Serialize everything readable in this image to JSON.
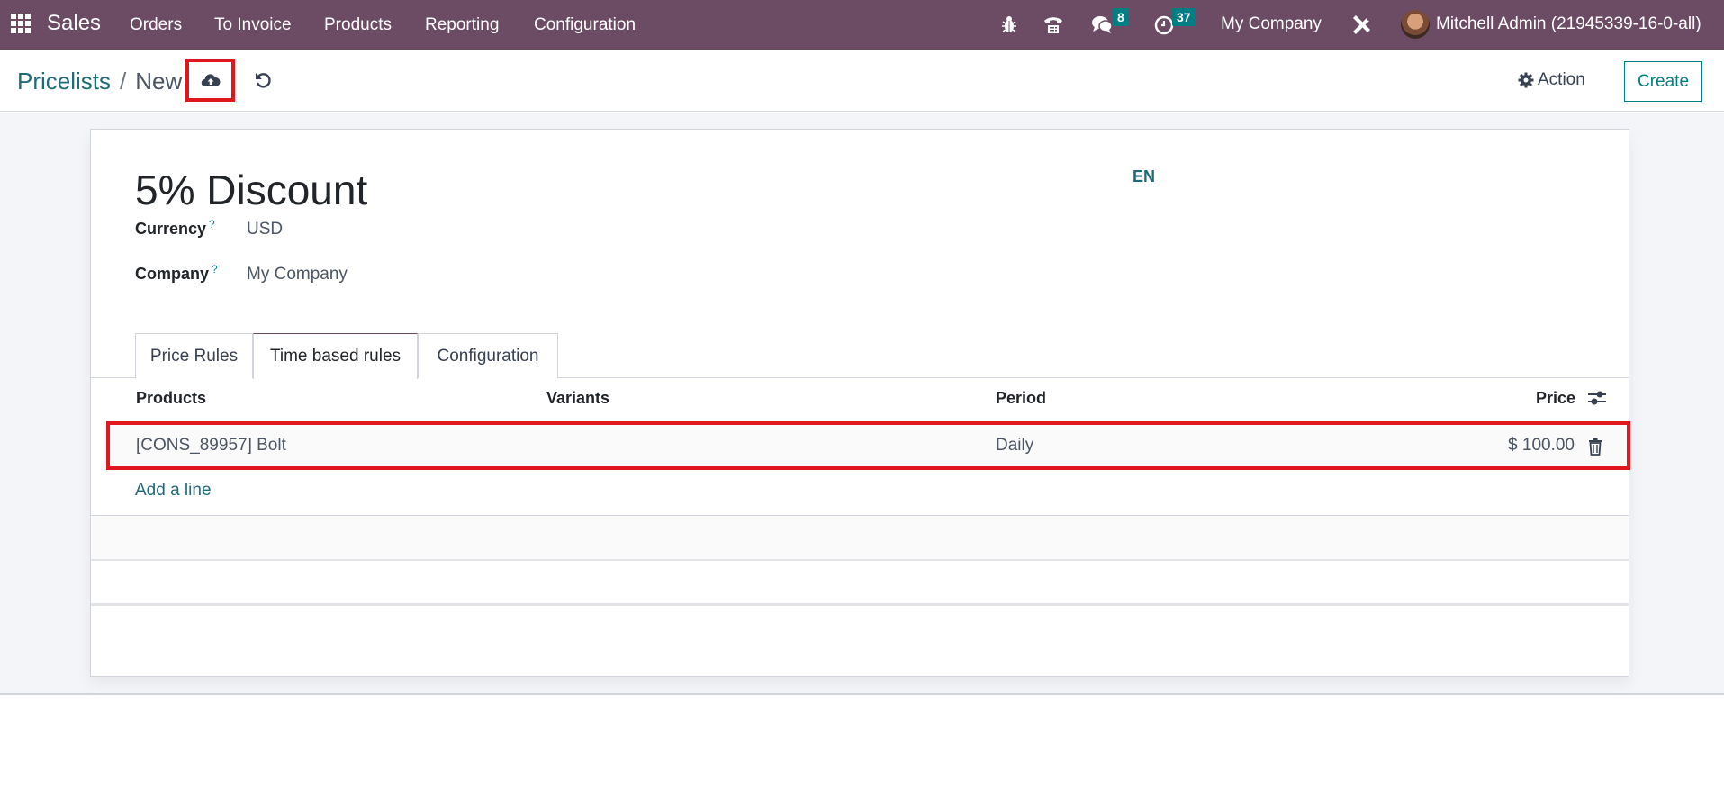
{
  "navbar": {
    "app_name": "Sales",
    "menu": [
      "Orders",
      "To Invoice",
      "Products",
      "Reporting",
      "Configuration"
    ],
    "messages_count": "8",
    "activities_count": "37",
    "company": "My Company",
    "user": "Mitchell Admin (21945339-16-0-all)",
    "icons": [
      "apps-icon",
      "bug-icon",
      "phone-icon",
      "chat-icon",
      "clock-icon",
      "tools-icon",
      "avatar"
    ],
    "color": "#6b4c64"
  },
  "control_panel": {
    "breadcrumb_parent": "Pricelists",
    "breadcrumb_separator": "/",
    "breadcrumb_current": "New",
    "action_label": "Action",
    "create_label": "Create",
    "save_icon": "cloud-upload-icon",
    "discard_icon": "undo-icon"
  },
  "form": {
    "name": "5% Discount",
    "lang": "EN",
    "fields": [
      {
        "label": "Currency",
        "help": "?",
        "value": "USD"
      },
      {
        "label": "Company",
        "help": "?",
        "value": "My Company"
      }
    ],
    "tabs": [
      {
        "label": "Price Rules",
        "active": false
      },
      {
        "label": "Time based rules",
        "active": true
      },
      {
        "label": "Configuration",
        "active": false
      }
    ],
    "table": {
      "columns": [
        "Products",
        "Variants",
        "Period",
        "Price"
      ],
      "rows": [
        {
          "product": "[CONS_89957] Bolt",
          "variants": "",
          "period": "Daily",
          "price": "$ 100.00"
        }
      ],
      "add_line_label": "Add a line"
    }
  },
  "colors": {
    "accent": "#017e84",
    "link": "#1f6b77",
    "highlight": "#e0171f"
  }
}
